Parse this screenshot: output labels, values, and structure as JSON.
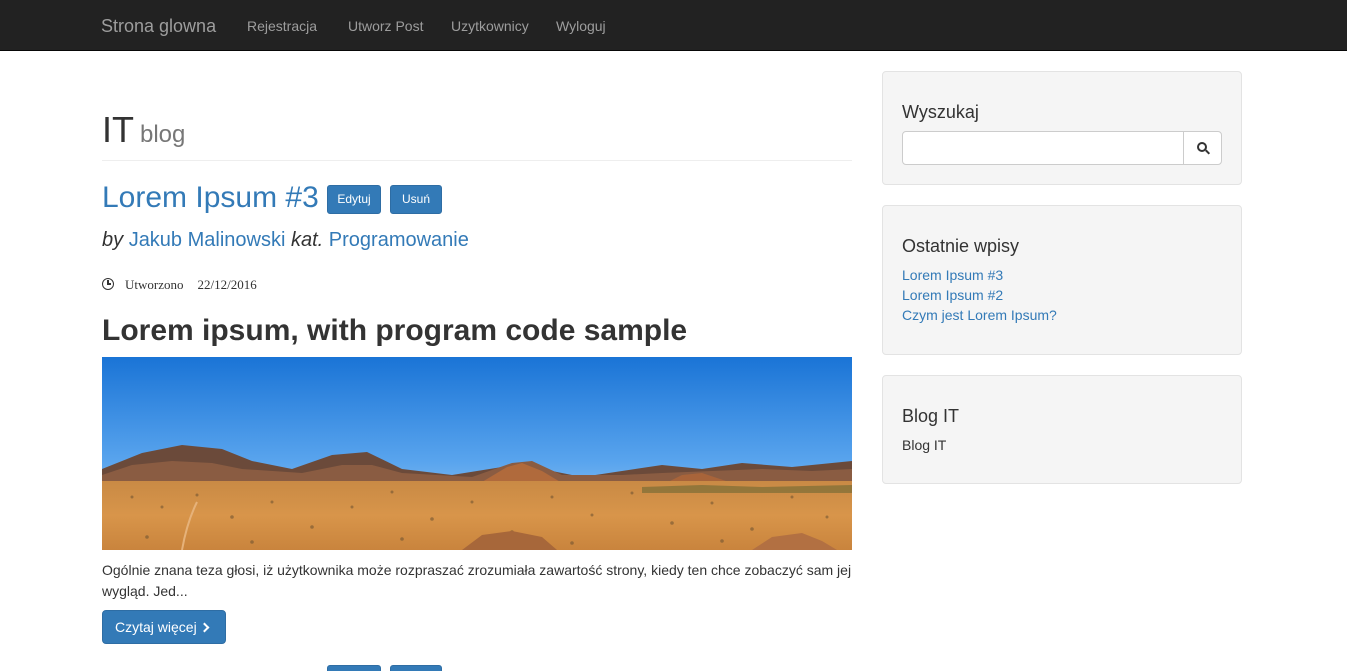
{
  "nav": {
    "brand": "Strona glowna",
    "links": [
      "Rejestracja",
      "Utworz Post",
      "Uzytkownicy",
      "Wyloguj"
    ]
  },
  "header": {
    "title": "IT",
    "subtitle": "blog"
  },
  "post": {
    "title": "Lorem Ipsum #3",
    "edit_label": "Edytuj",
    "delete_label": "Usuń",
    "by_label": "by",
    "author": "Jakub Malinowski",
    "category_label": "kat.",
    "category": "Programowanie",
    "created_label": "Utworzono",
    "date": "22/12/2016",
    "heading": "Lorem ipsum, with program code sample",
    "excerpt": "Ogólnie znana teza głosi, iż użytkownika może rozpraszać zrozumiała zawartość strony, kiedy ten chce zobaczyć sam jej wygląd. Jed...",
    "read_more_label": "Czytaj więcej",
    "image_icon": "desert-landscape-image"
  },
  "sidebar": {
    "search": {
      "title": "Wyszukaj",
      "value": "",
      "placeholder": "",
      "button_icon": "search-icon"
    },
    "recent": {
      "title": "Ostatnie wpisy",
      "items": [
        "Lorem Ipsum #3",
        "Lorem Ipsum #2",
        "Czym jest Lorem Ipsum?"
      ]
    },
    "about": {
      "title": "Blog IT",
      "text": "Blog IT"
    }
  },
  "colors": {
    "navbar": "#222222",
    "link": "#337ab7",
    "primary_button": "#337ab7",
    "well_background": "#f5f5f5"
  }
}
